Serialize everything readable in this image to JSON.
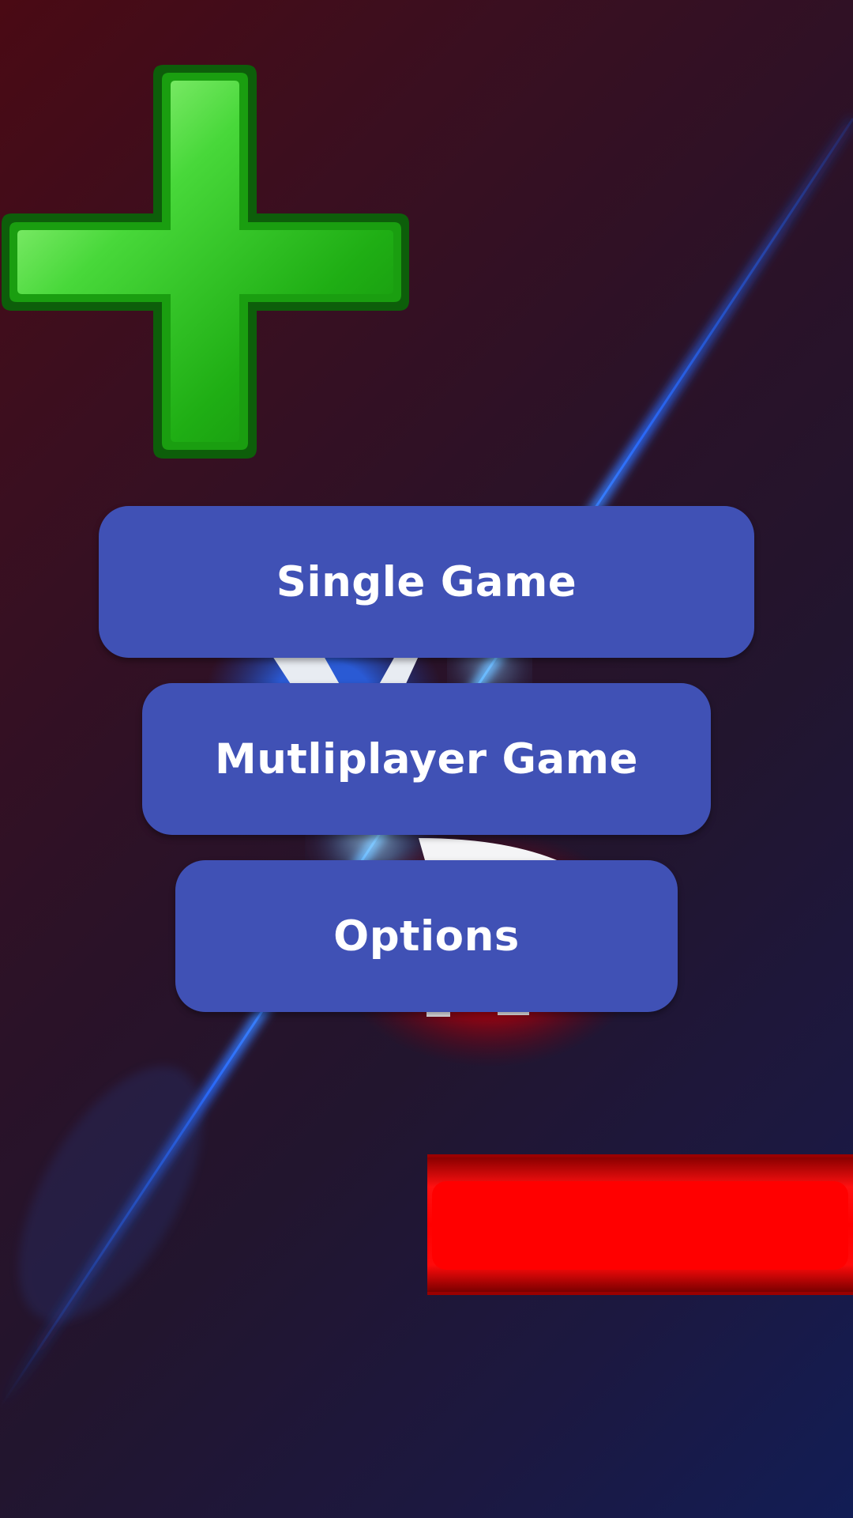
{
  "menu": {
    "single_game_label": "Single Game",
    "multiplayer_game_label": "Mutliplayer Game",
    "options_label": "Options"
  },
  "icons": {
    "plus": "plus-icon",
    "minus": "minus-icon",
    "logo": "captain-shield-logo"
  },
  "colors": {
    "button_bg": "#4051b5",
    "button_text": "#ffffff",
    "plus_green": "#22c41a",
    "minus_red": "#ff0000",
    "background_top_left": "#4a0a14",
    "background_bottom_right": "#121d55",
    "light_streak": "#2a6cff"
  }
}
